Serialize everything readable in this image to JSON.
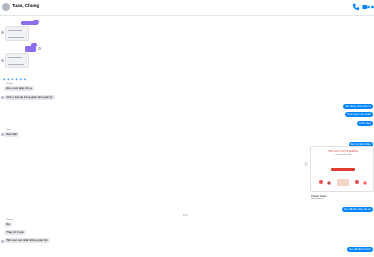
{
  "header": {
    "contact_name": "Tuan, Chung",
    "call_icon": "phone-icon",
    "video_icon": "video-camera-icon",
    "info_icon": "info-icon",
    "accent_color": "#0084ff"
  },
  "messages": {
    "in_1": "Để e xem giúp cho ạ",
    "in_2": "Chờ e trao lại trung giam bên quản lý",
    "out_1": "Bé đang chờ khen à",
    "out_2": "Tưa tuyệt vòa nhiệt",
    "out_3": "Tưởi cảm",
    "in_3": "Dạo thật",
    "out_4": "Em có lãnh điệu",
    "out_5": "https://timekeeper/link/",
    "card_title": "TRỞ LẠI LỊ VƯỢT MUỖNG",
    "card_sub": "chương trình ưu đãi",
    "card_caption": "Check Gues",
    "card_caption_sub": "timekeeper.vn",
    "out_6": "Em đã làm đây tốt nè",
    "time_divider": "9:24",
    "in_4": "Dạ",
    "in_5": "Thay rở ở ạnn",
    "in_6": "Tiền xem xét nhất nhất ạ giúp nhì",
    "out_7": "Em đã lãnh bởnh"
  },
  "senders": {
    "a": "Chung",
    "b": "Tuan"
  },
  "attachments": {
    "thumb_text_1": "Công việc đưa ra",
    "thumb_text_2": "Lỗi nghiệp lớn"
  }
}
